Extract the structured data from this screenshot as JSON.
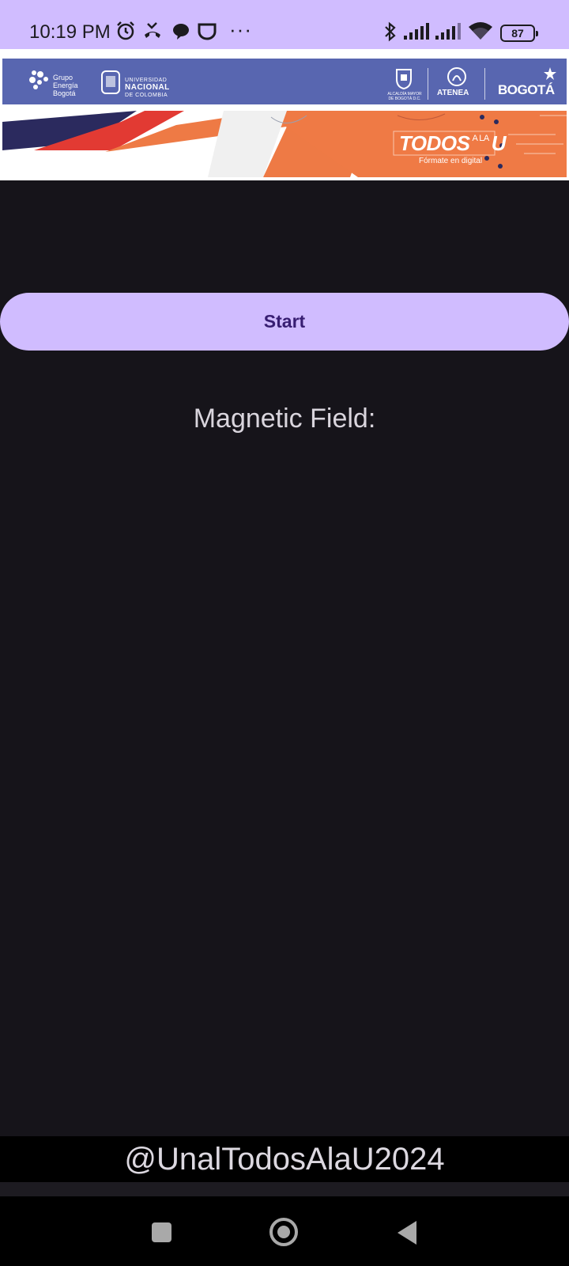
{
  "status_bar": {
    "time": "10:19 PM",
    "icons": [
      "alarm-icon",
      "missed-call-icon",
      "chat-bubble-icon",
      "app-notification-icon"
    ],
    "more": "···",
    "right_icons": [
      "bluetooth-icon",
      "signal-1-icon",
      "signal-2-icon",
      "wifi-icon"
    ],
    "battery": "87"
  },
  "banner": {
    "logos": {
      "grupo": [
        "Grupo",
        "Energía",
        "Bogotá"
      ],
      "unal": [
        "UNIVERSIDAD",
        "NACIONAL",
        "DE COLOMBIA"
      ],
      "alcaldia": [
        "ALCALDÍA MAYOR",
        "DE BOGOTÁ D.C."
      ],
      "atenea": "ATENEA",
      "bogota": "BOGOTÁ"
    },
    "promo_title_1": "TODOS",
    "promo_title_small": "A LA",
    "promo_title_2": "U",
    "promo_subtitle": "Fórmate en digital",
    "accent_colors": {
      "logo_strip": "#5866b0",
      "orange": "#ee7a45",
      "red": "#e23a33",
      "navy": "#2b2a5e"
    }
  },
  "main": {
    "start_label": "Start",
    "field_label": "Magnetic Field:"
  },
  "footer": {
    "handle": "@UnalTodosAlaU2024"
  },
  "nav": {
    "recents": "recents-icon",
    "home": "home-icon",
    "back": "back-icon"
  },
  "colors": {
    "primary": "#d0bcff",
    "on_primary": "#381e72",
    "background": "#16141a",
    "text": "#d9d5dd"
  }
}
